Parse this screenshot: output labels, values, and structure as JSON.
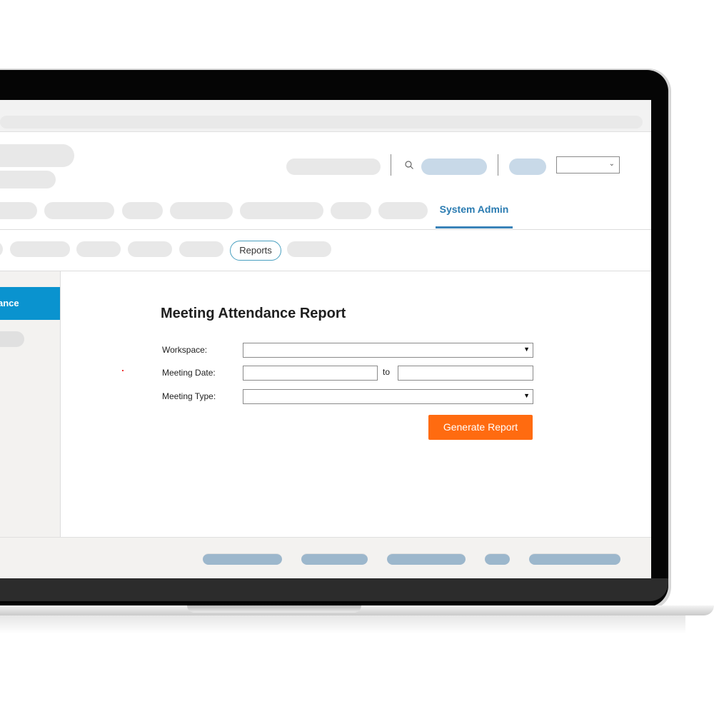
{
  "nav": {
    "active_tab": "System Admin"
  },
  "subnav": {
    "active_tab": "Reports"
  },
  "sidebar": {
    "active_item": "ance"
  },
  "form": {
    "title": "Meeting Attendance Report",
    "workspace_label": "Workspace:",
    "workspace_value": "",
    "meeting_date_label": "Meeting Date:",
    "date_from_value": "",
    "date_separator": "to",
    "date_to_value": "",
    "meeting_type_label": "Meeting Type:",
    "meeting_type_value": "",
    "generate_button": "Generate Report"
  },
  "icons": {
    "search": "search-icon",
    "dropdown": "caret-down-icon",
    "chevron": "chevron-down-icon"
  },
  "colors": {
    "accent_blue": "#0a93cf",
    "nav_active": "#2a7bb1",
    "button_orange": "#ff6b10",
    "placeholder_pill": "#e8e8e8",
    "placeholder_blue": "#c8d9e8",
    "footer_pill": "#9cb7cc"
  }
}
